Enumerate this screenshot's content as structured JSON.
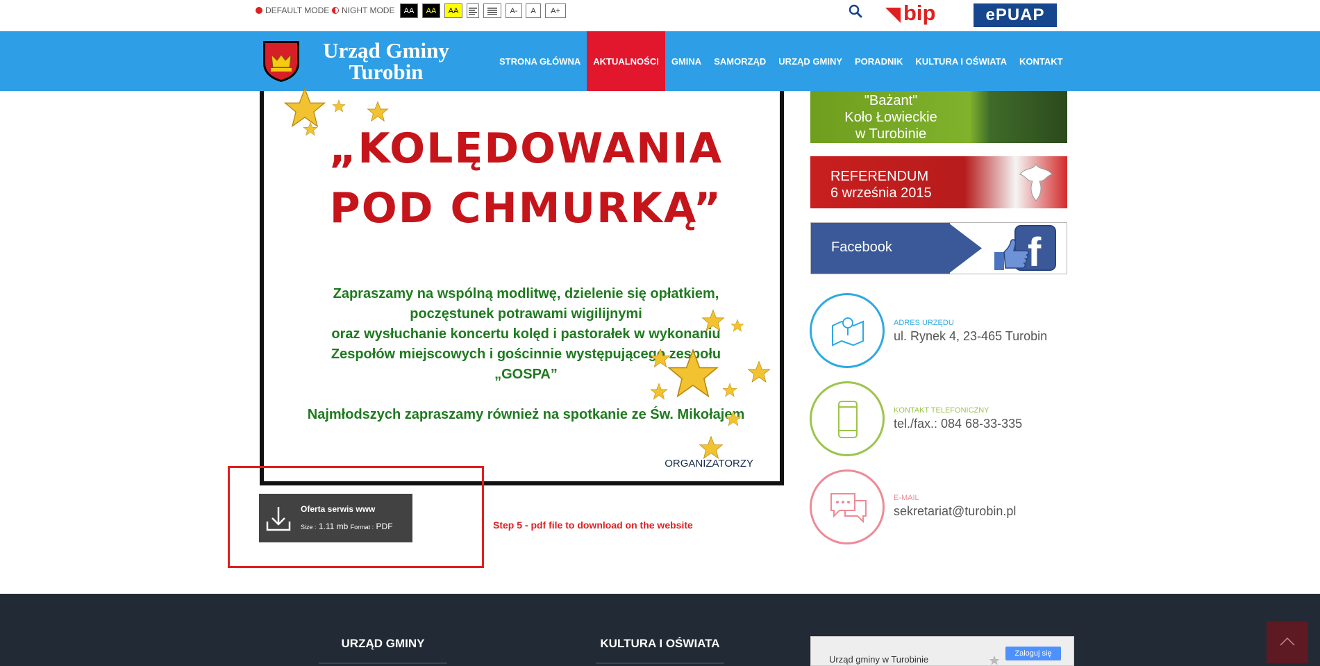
{
  "toolbar": {
    "default_mode": "DEFAULT MODE",
    "night_mode": "NIGHT MODE",
    "contrast_buttons": [
      "AA",
      "AA",
      "AA"
    ],
    "font_buttons": [
      "A-",
      "A",
      "A+"
    ],
    "bip_label": "bip",
    "epuap_label": "ePUAP"
  },
  "header": {
    "brand_line1": "Urząd Gminy",
    "brand_line2": "Turobin",
    "menu": [
      {
        "label": "STRONA GŁÓWNA",
        "active": false
      },
      {
        "label": "AKTUALNOŚCI",
        "active": true
      },
      {
        "label": "GMINA",
        "active": false
      },
      {
        "label": "SAMORZĄD",
        "active": false
      },
      {
        "label": "URZĄD GMINY",
        "active": false
      },
      {
        "label": "PORADNIK",
        "active": false
      },
      {
        "label": "KULTURA I OŚWIATA",
        "active": false
      },
      {
        "label": "KONTAKT",
        "active": false
      }
    ]
  },
  "poster": {
    "title_line1": "„KOLĘDOWANIA",
    "title_line2": "POD CHMURKĄ”",
    "text_lines": [
      "Zapraszamy na wspólną modlitwę, dzielenie się opłatkiem,",
      "poczęstunek potrawami wigilijnymi",
      "oraz wysłuchanie koncertu kolęd i pastorałek w wykonaniu",
      "Zespołów miejscowych i gościnnie występującego zespołu",
      "„GOSPA”"
    ],
    "kids_line": "Najmłodszych zapraszamy również  na spotkanie ze Św. Mikołajem",
    "signature": "ORGANIZATORZY"
  },
  "download": {
    "title": "Oferta serwis www",
    "size_label": "Size :",
    "size_value": "1.11 mb",
    "format_label": "Format :",
    "format_value": "PDF"
  },
  "annotation": "Step 5 - pdf file to download on the website",
  "sidebar": {
    "hunt_banner": [
      "\"Bażant\"",
      "Koło Łowieckie",
      "w Turobinie"
    ],
    "referendum_banner": [
      "REFERENDUM",
      "6 września 2015"
    ],
    "facebook_banner": "Facebook",
    "contacts": [
      {
        "label": "ADRES URZĘDU",
        "value": "ul. Rynek 4, 23-465 Turobin",
        "color": "#2ea9e2"
      },
      {
        "label": "KONTAKT TELEFONICZNY",
        "value": "tel./fax.: 084 68-33-335",
        "color": "#9cc54a"
      },
      {
        "label": "E-MAIL",
        "value": "sekretariat@turobin.pl",
        "color": "#ee8a96"
      }
    ]
  },
  "footer": {
    "col1": "URZĄD GMINY",
    "col2": "KULTURA I OŚWIATA",
    "map_title": "Urząd gminy w Turobinie",
    "map_login": "Zaloguj się"
  },
  "colors": {
    "nav_blue": "#2e9fe6",
    "active_red": "#e2162d",
    "footer_dark": "#222b35"
  }
}
